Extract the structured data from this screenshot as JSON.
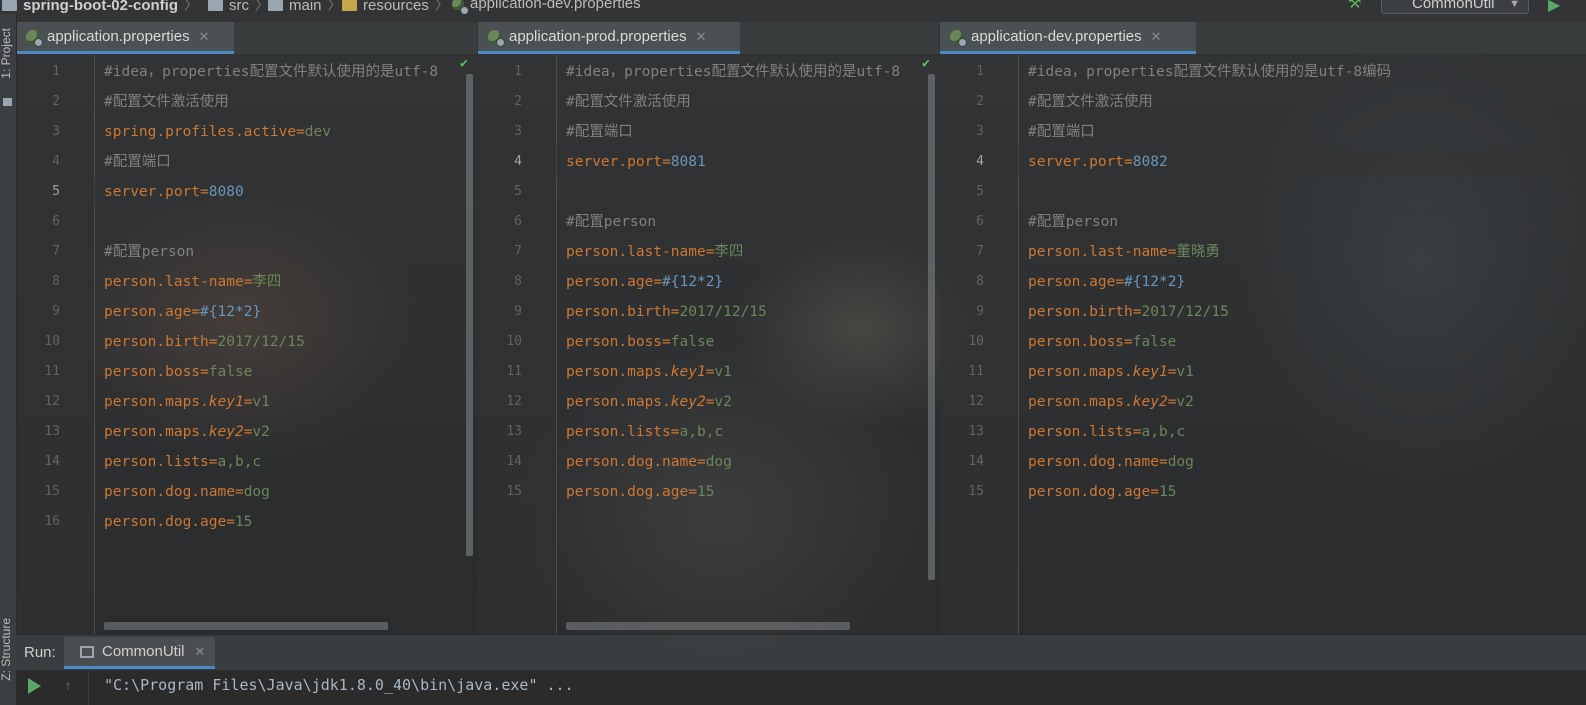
{
  "breadcrumb": {
    "project": "spring-boot-02-config",
    "src": "src",
    "main": "main",
    "resources": "resources",
    "file": "application-dev.properties"
  },
  "run_config": {
    "name": "CommonUtil"
  },
  "side_labels": {
    "project": "1: Project",
    "structure": "Z: Structure"
  },
  "panes": [
    {
      "tab": "application.properties",
      "current_line": 5,
      "lines": [
        {
          "n": "1",
          "t": "comment",
          "text": "#idea，properties配置文件默认使用的是utf-8"
        },
        {
          "n": "2",
          "t": "comment",
          "text": "#配置文件激活使用"
        },
        {
          "n": "3",
          "t": "kv",
          "key": "spring.profiles.active",
          "value": "dev"
        },
        {
          "n": "4",
          "t": "comment",
          "text": "#配置端口"
        },
        {
          "n": "5",
          "t": "kv",
          "key": "server.port",
          "value": "8080",
          "vt": "num"
        },
        {
          "n": "6",
          "t": "blank",
          "text": ""
        },
        {
          "n": "7",
          "t": "comment",
          "text": "#配置person"
        },
        {
          "n": "8",
          "t": "kv",
          "key": "person.last-name",
          "value": "李四"
        },
        {
          "n": "9",
          "t": "kv",
          "key": "person.age",
          "value": "#{12*2}",
          "vt": "num"
        },
        {
          "n": "10",
          "t": "kv",
          "key": "person.birth",
          "value": "2017/12/15"
        },
        {
          "n": "11",
          "t": "kv",
          "key": "person.boss",
          "value": "false"
        },
        {
          "n": "12",
          "t": "kvi",
          "key": "person.maps.",
          "ikey": "key1",
          "value": "v1"
        },
        {
          "n": "13",
          "t": "kvi",
          "key": "person.maps.",
          "ikey": "key2",
          "value": "v2"
        },
        {
          "n": "14",
          "t": "kv",
          "key": "person.lists",
          "value": "a,b,c"
        },
        {
          "n": "15",
          "t": "kv",
          "key": "person.dog.name",
          "value": "dog"
        },
        {
          "n": "16",
          "t": "kv",
          "key": "person.dog.age",
          "value": "15"
        }
      ]
    },
    {
      "tab": "application-prod.properties",
      "current_line": 4,
      "lines": [
        {
          "n": "1",
          "t": "comment",
          "text": "#idea，properties配置文件默认使用的是utf-8"
        },
        {
          "n": "2",
          "t": "comment",
          "text": "#配置文件激活使用"
        },
        {
          "n": "3",
          "t": "comment",
          "text": "#配置端口"
        },
        {
          "n": "4",
          "t": "kv",
          "key": "server.port",
          "value": "8081",
          "vt": "num"
        },
        {
          "n": "5",
          "t": "blank",
          "text": ""
        },
        {
          "n": "6",
          "t": "comment",
          "text": "#配置person"
        },
        {
          "n": "7",
          "t": "kv",
          "key": "person.last-name",
          "value": "李四"
        },
        {
          "n": "8",
          "t": "kv",
          "key": "person.age",
          "value": "#{12*2}",
          "vt": "num"
        },
        {
          "n": "9",
          "t": "kv",
          "key": "person.birth",
          "value": "2017/12/15"
        },
        {
          "n": "10",
          "t": "kv",
          "key": "person.boss",
          "value": "false"
        },
        {
          "n": "11",
          "t": "kvi",
          "key": "person.maps.",
          "ikey": "key1",
          "value": "v1"
        },
        {
          "n": "12",
          "t": "kvi",
          "key": "person.maps.",
          "ikey": "key2",
          "value": "v2"
        },
        {
          "n": "13",
          "t": "kv",
          "key": "person.lists",
          "value": "a,b,c"
        },
        {
          "n": "14",
          "t": "kv",
          "key": "person.dog.name",
          "value": "dog"
        },
        {
          "n": "15",
          "t": "kv",
          "key": "person.dog.age",
          "value": "15"
        }
      ]
    },
    {
      "tab": "application-dev.properties",
      "current_line": 4,
      "lines": [
        {
          "n": "1",
          "t": "comment",
          "text": "#idea，properties配置文件默认使用的是utf-8编码"
        },
        {
          "n": "2",
          "t": "comment",
          "text": "#配置文件激活使用"
        },
        {
          "n": "3",
          "t": "comment",
          "text": "#配置端口"
        },
        {
          "n": "4",
          "t": "kv",
          "key": "server.port",
          "value": "8082",
          "vt": "num"
        },
        {
          "n": "5",
          "t": "blank",
          "text": ""
        },
        {
          "n": "6",
          "t": "comment",
          "text": "#配置person"
        },
        {
          "n": "7",
          "t": "kv",
          "key": "person.last-name",
          "value": "董晓勇"
        },
        {
          "n": "8",
          "t": "kv",
          "key": "person.age",
          "value": "#{12*2}",
          "vt": "num"
        },
        {
          "n": "9",
          "t": "kv",
          "key": "person.birth",
          "value": "2017/12/15"
        },
        {
          "n": "10",
          "t": "kv",
          "key": "person.boss",
          "value": "false"
        },
        {
          "n": "11",
          "t": "kvi",
          "key": "person.maps.",
          "ikey": "key1",
          "value": "v1"
        },
        {
          "n": "12",
          "t": "kvi",
          "key": "person.maps.",
          "ikey": "key2",
          "value": "v2"
        },
        {
          "n": "13",
          "t": "kv",
          "key": "person.lists",
          "value": "a,b,c"
        },
        {
          "n": "14",
          "t": "kv",
          "key": "person.dog.name",
          "value": "dog"
        },
        {
          "n": "15",
          "t": "kv",
          "key": "person.dog.age",
          "value": "15"
        }
      ]
    }
  ],
  "run_panel": {
    "label": "Run:",
    "tab": "CommonUtil",
    "console_line": "\"C:\\Program Files\\Java\\jdk1.8.0_40\\bin\\java.exe\" ..."
  },
  "colors": {
    "comment": "#808080",
    "key": "#cc7832",
    "string_value": "#6a8759",
    "number_value": "#6897bb",
    "accent": "#4a88c7"
  }
}
